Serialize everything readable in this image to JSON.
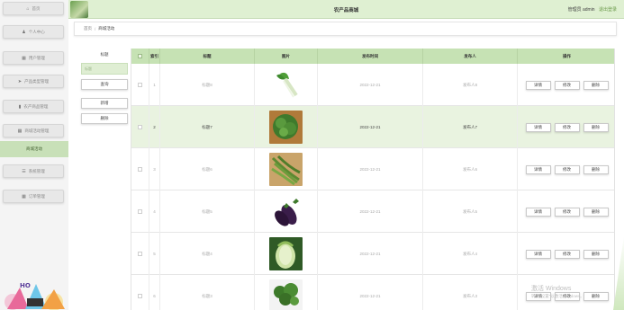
{
  "header": {
    "app_title": "农产品商城",
    "user_label": "管理员 admin",
    "logout_label": "退出登录"
  },
  "sidebar": {
    "items": [
      {
        "icon": "home-icon",
        "glyph": "⌂",
        "label": "首页"
      },
      {
        "icon": "user-icon",
        "glyph": "♟",
        "label": "个人中心"
      },
      {
        "icon": "users-icon",
        "glyph": "▦",
        "label": "用户管理"
      },
      {
        "icon": "send-icon",
        "glyph": "➤",
        "label": "产品类型管理"
      },
      {
        "icon": "chart-icon",
        "glyph": "▮",
        "label": "农产商品管理"
      },
      {
        "icon": "grid-icon",
        "glyph": "▦",
        "label": "商城活动管理"
      },
      {
        "icon": "list-icon",
        "glyph": "☰",
        "label": "系统管理"
      },
      {
        "icon": "grid-icon",
        "glyph": "▦",
        "label": "订单管理"
      }
    ],
    "active_sub": "商城活动"
  },
  "breadcrumb": {
    "home": "首页",
    "separator": "/",
    "current": "商城活动"
  },
  "search": {
    "label": "标题",
    "placeholder": "标题",
    "query_button": "查询",
    "add_button": "新增",
    "delete_button": "删除"
  },
  "table": {
    "columns": [
      "",
      "索引",
      "标题",
      "图片",
      "发布时间",
      "发布人",
      "操作"
    ],
    "rows": [
      {
        "index": "1",
        "title": "标题8",
        "image": "leafy-vegetable",
        "time": "2022-12-21",
        "publisher": "发布人8"
      },
      {
        "index": "2",
        "title": "标题7",
        "image": "lettuce",
        "time": "2022-12-21",
        "publisher": "发布人7"
      },
      {
        "index": "3",
        "title": "标题6",
        "image": "green-beans",
        "time": "2022-12-21",
        "publisher": "发布人6"
      },
      {
        "index": "4",
        "title": "标题5",
        "image": "eggplant",
        "time": "2022-12-21",
        "publisher": "发布人5"
      },
      {
        "index": "5",
        "title": "标题4",
        "image": "cabbage",
        "time": "2022-12-21",
        "publisher": "发布人4"
      },
      {
        "index": "6",
        "title": "标题3",
        "image": "broccoli",
        "time": "2022-12-21",
        "publisher": "发布人3"
      }
    ],
    "actions": {
      "detail": "详情",
      "edit": "修改",
      "delete": "删除"
    }
  },
  "watermark": {
    "line1": "激活 Windows",
    "line2": "转到\"设置\"以激活 Windows。"
  },
  "colors": {
    "accent": "#c6e2b4",
    "header_bg": "#dff0d2",
    "active_bg": "#c8e0b8"
  }
}
